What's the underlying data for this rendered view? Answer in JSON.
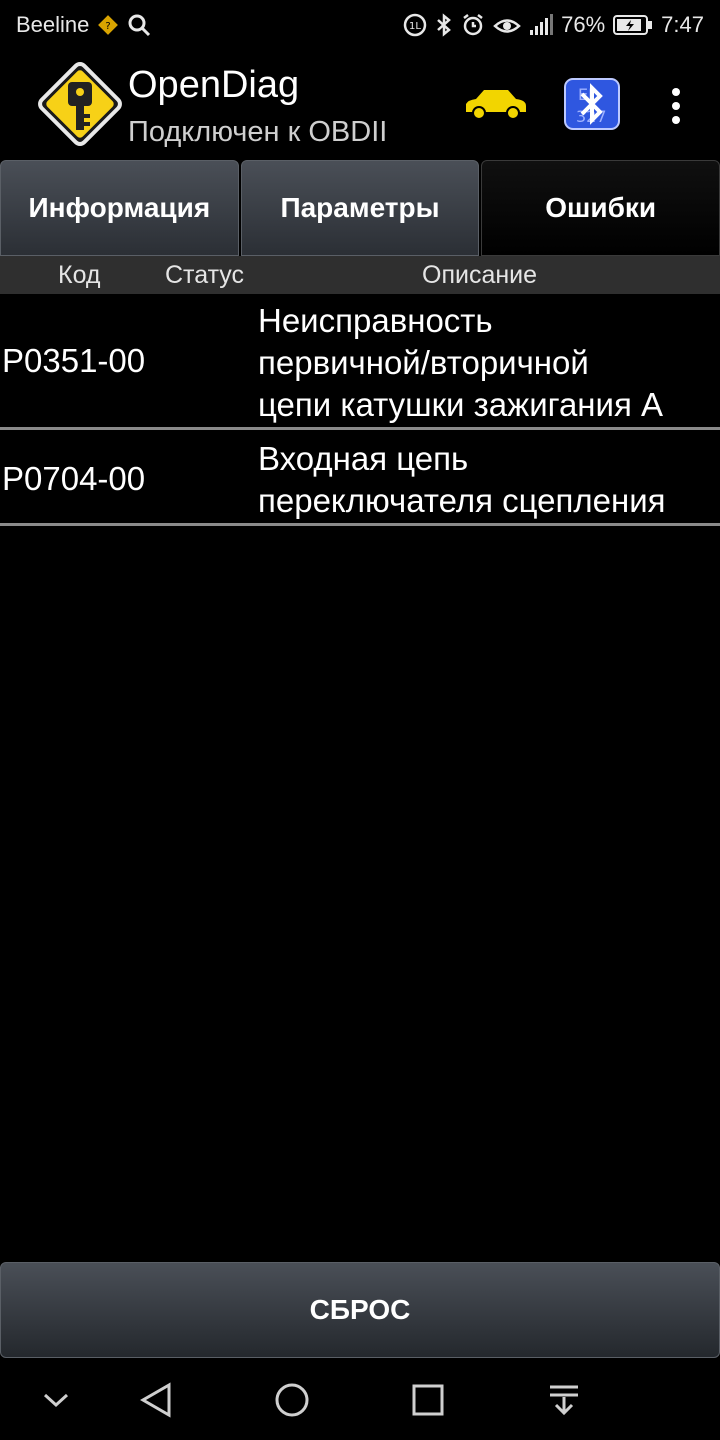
{
  "status_bar": {
    "carrier": "Beeline",
    "battery": "76%",
    "time": "7:47",
    "icons": [
      "diamond-sim-icon",
      "search-icon",
      "volte-icon",
      "bluetooth-icon",
      "alarm-icon",
      "eye-icon",
      "signal-icon",
      "battery-icon"
    ]
  },
  "app": {
    "title": "OpenDiag",
    "subtitle": "Подключен к OBDII",
    "logo_icon": "key-warning-logo",
    "action_icons": [
      "car-icon",
      "bluetooth-elm327-icon",
      "overflow-menu-icon"
    ],
    "bt_badge_text": "ELM 327",
    "colors": {
      "logo_yellow": "#f7d117",
      "car_yellow": "#f2d500",
      "bt_blue": "#2f57e0"
    }
  },
  "tabs": [
    {
      "label": "Информация",
      "active": false
    },
    {
      "label": "Параметры",
      "active": false
    },
    {
      "label": "Ошибки",
      "active": true
    }
  ],
  "table": {
    "headers": {
      "code": "Код",
      "status": "Статус",
      "description": "Описание"
    },
    "rows": [
      {
        "code": "P0351-00",
        "status": "",
        "description_lines": [
          "Неисправность",
          "первичной/вторичной",
          "цепи катушки зажигания А"
        ]
      },
      {
        "code": "P0704-00",
        "status": "",
        "description_lines": [
          "Входная цепь",
          "переключателя сцепления"
        ]
      }
    ]
  },
  "reset_button": {
    "label": "СБРОС"
  },
  "nav_bar": {
    "icons": [
      "chevron-down-icon",
      "back-icon",
      "home-icon",
      "recents-icon",
      "notification-pull-icon"
    ]
  }
}
